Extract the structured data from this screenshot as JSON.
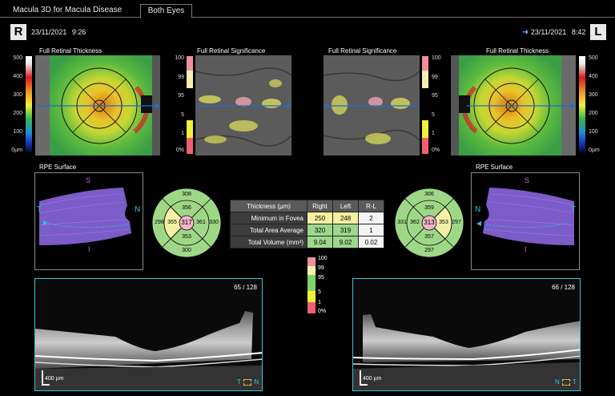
{
  "tabs": [
    {
      "label": "Macula 3D for Macula Disease",
      "active": false
    },
    {
      "label": "Both Eyes",
      "active": true
    }
  ],
  "right_eye": {
    "badge": "R",
    "date": "23/11/2021",
    "time": "9:26",
    "thickness_title": "Full Retinal Thickness",
    "significance_title": "Full Retinal Significance",
    "rpe_title": "RPE Surface",
    "rpe_labels": {
      "s": "S",
      "t": "T",
      "n": "N",
      "i": "I"
    },
    "etdrs": {
      "center": "317",
      "inner_s": "356",
      "inner_t": "355",
      "inner_n": "361",
      "inner_i": "353",
      "outer_s": "308",
      "outer_t": "298",
      "outer_n": "330",
      "outer_i": "300"
    },
    "slice": "65 / 128",
    "scale_label": "400 µm",
    "orient_left": "T",
    "orient_right": "N"
  },
  "left_eye": {
    "badge": "L",
    "date": "23/11/2021",
    "time": "8:42",
    "thickness_title": "Full Retinal Thickness",
    "significance_title": "Full Retinal Significance",
    "rpe_title": "RPE Surface",
    "rpe_labels": {
      "s": "S",
      "t": "T",
      "n": "N",
      "i": "I"
    },
    "etdrs": {
      "center": "313",
      "inner_s": "359",
      "inner_t": "362",
      "inner_n": "353",
      "inner_i": "357",
      "outer_s": "306",
      "outer_t": "331",
      "outer_n": "297",
      "outer_i": "297"
    },
    "slice": "66 / 128",
    "scale_label": "400 µm",
    "orient_left": "N",
    "orient_right": "T"
  },
  "thickness_scale": [
    "500",
    "400",
    "300",
    "200",
    "100",
    "0µm"
  ],
  "significance_scale": [
    "100",
    "99",
    "95",
    "5",
    "1",
    "0%"
  ],
  "significance_legend": [
    "100",
    "99",
    "95",
    "5",
    "1",
    "0%"
  ],
  "colors": {
    "sig_pink": "#f08f99",
    "sig_lightyellow": "#f7f1b0",
    "sig_green": "#7fd46b",
    "sig_yellow": "#f2ef3c",
    "sig_red": "#f0606c",
    "etdrs_green": "#9ed887",
    "etdrs_yellow": "#f4f0a6",
    "etdrs_pink": "#f2b5c6",
    "oct_border": "#3cc3d3"
  },
  "thickness_table": {
    "headers": [
      "Thickness (µm)",
      "Right",
      "Left",
      "R-L"
    ],
    "rows": [
      [
        "Minimum in Fovea",
        "250",
        "248",
        "2"
      ],
      [
        "Total Area Average",
        "320",
        "319",
        "1"
      ],
      [
        "Total Volume (mm³)",
        "9.04",
        "9.02",
        "0.02"
      ]
    ]
  }
}
